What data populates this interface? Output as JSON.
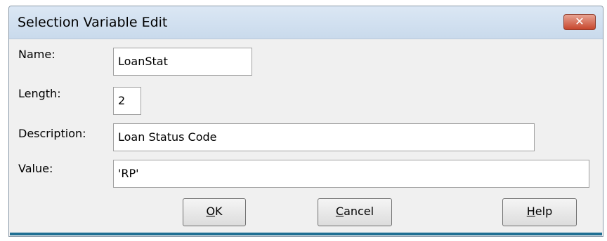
{
  "window": {
    "title": "Selection Variable Edit",
    "close_glyph": "✕"
  },
  "fields": {
    "name": {
      "label": "Name:",
      "value": "LoanStat"
    },
    "length": {
      "label": "Length:",
      "value": "2"
    },
    "description": {
      "label": "Description:",
      "value": "Loan Status Code"
    },
    "value": {
      "label": "Value:",
      "value": "'RP'"
    }
  },
  "buttons": {
    "ok": {
      "access_key": "O",
      "rest": "K"
    },
    "cancel": {
      "access_key": "C",
      "rest": "ancel"
    },
    "help": {
      "access_key": "H",
      "rest": "elp"
    }
  },
  "colors": {
    "titlebar": "#d3e2f1",
    "close_button": "#c7462d",
    "dialog_background": "#f0f0f0"
  }
}
